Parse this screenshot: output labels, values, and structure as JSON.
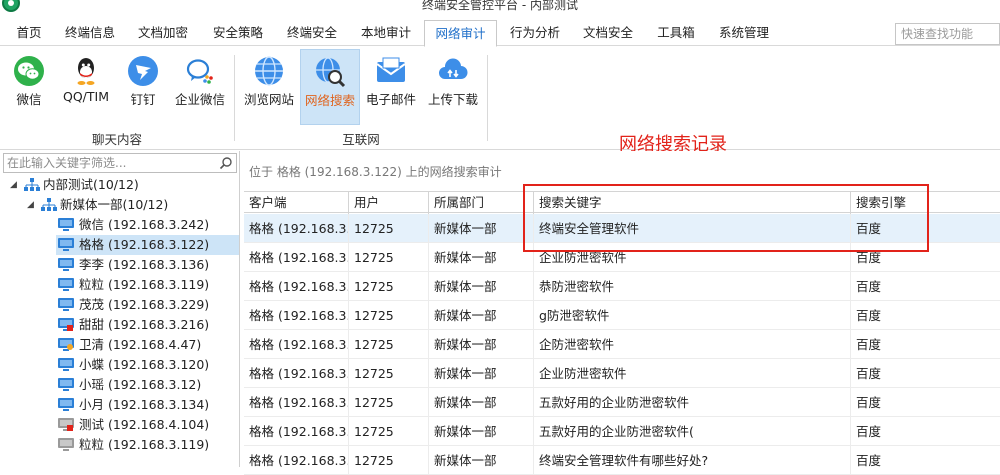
{
  "window": {
    "title": "终端安全管控平台 - 内部测试"
  },
  "menu": {
    "tabs": [
      {
        "label": "首页"
      },
      {
        "label": "终端信息"
      },
      {
        "label": "文档加密"
      },
      {
        "label": "安全策略"
      },
      {
        "label": "终端安全"
      },
      {
        "label": "本地审计"
      },
      {
        "label": "网络审计"
      },
      {
        "label": "行为分析"
      },
      {
        "label": "文档安全"
      },
      {
        "label": "工具箱"
      },
      {
        "label": "系统管理"
      }
    ],
    "active_tab": "网络审计",
    "quick_search_placeholder": "快速查找功能"
  },
  "ribbon": {
    "groups": [
      {
        "label": "聊天内容",
        "buttons": [
          {
            "label": "微信",
            "icon": "wechat-icon"
          },
          {
            "label": "QQ/TIM",
            "icon": "qq-icon"
          },
          {
            "label": "钉钉",
            "icon": "dingtalk-icon"
          },
          {
            "label": "企业微信",
            "icon": "wework-icon"
          }
        ]
      },
      {
        "label": "互联网",
        "buttons": [
          {
            "label": "浏览网站",
            "icon": "globe-icon"
          },
          {
            "label": "网络搜索",
            "icon": "web-search-icon",
            "selected": true
          },
          {
            "label": "电子邮件",
            "icon": "email-icon"
          },
          {
            "label": "上传下载",
            "icon": "cloud-transfer-icon"
          }
        ]
      }
    ]
  },
  "annotation": {
    "title": "网络搜索记录",
    "color": "#e2231a"
  },
  "tree": {
    "filter_placeholder": "在此输入关键字筛选...",
    "root": "内部测试(10/12)",
    "group": "新媒体一部(10/12)",
    "clients": [
      {
        "label": "微信 (192.168.3.242)",
        "status": "online"
      },
      {
        "label": "格格 (192.168.3.122)",
        "status": "online",
        "selected": true
      },
      {
        "label": "李李 (192.168.3.136)",
        "status": "online"
      },
      {
        "label": "粒粒 (192.168.3.119)",
        "status": "online"
      },
      {
        "label": "茂茂 (192.168.3.229)",
        "status": "online"
      },
      {
        "label": "甜甜 (192.168.3.216)",
        "status": "online-flag"
      },
      {
        "label": "卫清 (192.168.4.47)",
        "status": "online-user"
      },
      {
        "label": "小蝶 (192.168.3.120)",
        "status": "online"
      },
      {
        "label": "小瑶 (192.168.3.12)",
        "status": "online"
      },
      {
        "label": "小月 (192.168.3.134)",
        "status": "online"
      },
      {
        "label": "测试 (192.168.4.104)",
        "status": "offline-flag"
      },
      {
        "label": "粒粒 (192.168.3.119)",
        "status": "offline"
      }
    ]
  },
  "content": {
    "location_text": "位于 格格 (192.168.3.122) 上的网络搜索审计",
    "columns": [
      "客户端",
      "用户",
      "所属部门",
      "搜索关键字",
      "搜索引擎"
    ],
    "rows": [
      [
        "格格 (192.168.3...",
        "12725",
        "新媒体一部",
        "终端安全管理软件",
        "百度"
      ],
      [
        "格格 (192.168.3...",
        "12725",
        "新媒体一部",
        "企业防泄密软件",
        "百度"
      ],
      [
        "格格 (192.168.3...",
        "12725",
        "新媒体一部",
        "恭防泄密软件",
        "百度"
      ],
      [
        "格格 (192.168.3...",
        "12725",
        "新媒体一部",
        "g防泄密软件",
        "百度"
      ],
      [
        "格格 (192.168.3...",
        "12725",
        "新媒体一部",
        "企防泄密软件",
        "百度"
      ],
      [
        "格格 (192.168.3...",
        "12725",
        "新媒体一部",
        "企业防泄密软件",
        "百度"
      ],
      [
        "格格 (192.168.3...",
        "12725",
        "新媒体一部",
        "五款好用的企业防泄密软件",
        "百度"
      ],
      [
        "格格 (192.168.3...",
        "12725",
        "新媒体一部",
        "五款好用的企业防泄密软件(",
        "百度"
      ],
      [
        "格格 (192.168.3...",
        "12725",
        "新媒体一部",
        "终端安全管理软件有哪些好处?",
        "百度"
      ]
    ],
    "selected_row": 0
  }
}
